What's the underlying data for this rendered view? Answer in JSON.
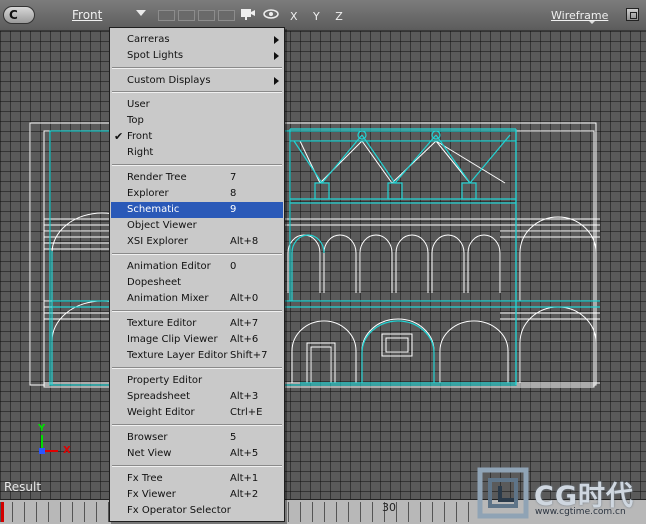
{
  "toolbar": {
    "camera_button": "C",
    "view_name": "Front",
    "axes": "X Y Z",
    "display_mode": "Wireframe"
  },
  "viewport": {
    "axis_y": "Y",
    "axis_x": "X",
    "result_label": "Result"
  },
  "timeline": {
    "frame_label": "30"
  },
  "watermark": {
    "brand": "CG时代",
    "url": "www.cgtime.com.cn"
  },
  "menu": {
    "items": [
      {
        "label": "Carreras",
        "shortcut": "",
        "submenu": true,
        "checked": false,
        "highlighted": false
      },
      {
        "label": "Spot Lights",
        "shortcut": "",
        "submenu": true,
        "checked": false,
        "highlighted": false
      },
      {
        "label": "Custom Displays",
        "shortcut": "",
        "submenu": true,
        "checked": false,
        "highlighted": false
      },
      {
        "label": "User",
        "shortcut": "",
        "submenu": false,
        "checked": false,
        "highlighted": false
      },
      {
        "label": "Top",
        "shortcut": "",
        "submenu": false,
        "checked": false,
        "highlighted": false
      },
      {
        "label": "Front",
        "shortcut": "",
        "submenu": false,
        "checked": true,
        "highlighted": false
      },
      {
        "label": "Right",
        "shortcut": "",
        "submenu": false,
        "checked": false,
        "highlighted": false
      },
      {
        "label": "Render Tree",
        "shortcut": "7",
        "submenu": false,
        "checked": false,
        "highlighted": false
      },
      {
        "label": "Explorer",
        "shortcut": "8",
        "submenu": false,
        "checked": false,
        "highlighted": false
      },
      {
        "label": "Schematic",
        "shortcut": "9",
        "submenu": false,
        "checked": false,
        "highlighted": true
      },
      {
        "label": "Object Viewer",
        "shortcut": "",
        "submenu": false,
        "checked": false,
        "highlighted": false
      },
      {
        "label": "XSI Explorer",
        "shortcut": "Alt+8",
        "submenu": false,
        "checked": false,
        "highlighted": false
      },
      {
        "label": "Animation Editor",
        "shortcut": "0",
        "submenu": false,
        "checked": false,
        "highlighted": false
      },
      {
        "label": "Dopesheet",
        "shortcut": "",
        "submenu": false,
        "checked": false,
        "highlighted": false
      },
      {
        "label": "Animation Mixer",
        "shortcut": "Alt+0",
        "submenu": false,
        "checked": false,
        "highlighted": false
      },
      {
        "label": "Texture Editor",
        "shortcut": "Alt+7",
        "submenu": false,
        "checked": false,
        "highlighted": false
      },
      {
        "label": "Image Clip Viewer",
        "shortcut": "Alt+6",
        "submenu": false,
        "checked": false,
        "highlighted": false
      },
      {
        "label": "Texture Layer Editor",
        "shortcut": "Shift+7",
        "submenu": false,
        "checked": false,
        "highlighted": false
      },
      {
        "label": "Property Editor",
        "shortcut": "",
        "submenu": false,
        "checked": false,
        "highlighted": false
      },
      {
        "label": "Spreadsheet",
        "shortcut": "Alt+3",
        "submenu": false,
        "checked": false,
        "highlighted": false
      },
      {
        "label": "Weight Editor",
        "shortcut": "Ctrl+E",
        "submenu": false,
        "checked": false,
        "highlighted": false
      },
      {
        "label": "Browser",
        "shortcut": "5",
        "submenu": false,
        "checked": false,
        "highlighted": false
      },
      {
        "label": "Net View",
        "shortcut": "Alt+5",
        "submenu": false,
        "checked": false,
        "highlighted": false
      },
      {
        "label": "Fx Tree",
        "shortcut": "Alt+1",
        "submenu": false,
        "checked": false,
        "highlighted": false
      },
      {
        "label": "Fx Viewer",
        "shortcut": "Alt+2",
        "submenu": false,
        "checked": false,
        "highlighted": false
      },
      {
        "label": "Fx Operator Selector",
        "shortcut": "",
        "submenu": false,
        "checked": false,
        "highlighted": false
      }
    ]
  },
  "colors": {
    "wire_white": "#ffffff",
    "wire_cyan": "#22d3d3",
    "menu_highlight": "#2a59b8",
    "timeline_marker": "#d40000"
  }
}
